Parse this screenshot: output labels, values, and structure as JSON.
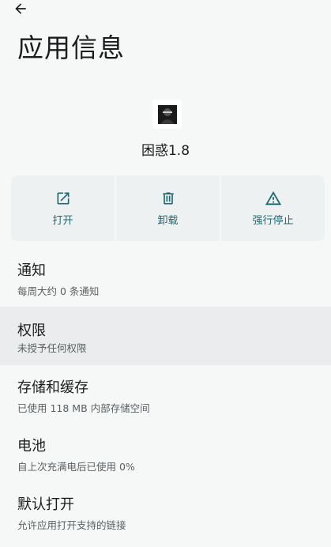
{
  "header": {
    "title": "应用信息"
  },
  "app": {
    "name": "困惑1.8"
  },
  "actions": [
    {
      "label": "打开",
      "icon": "open-external-icon"
    },
    {
      "label": "卸载",
      "icon": "trash-icon"
    },
    {
      "label": "强行停止",
      "icon": "warning-icon"
    }
  ],
  "settings": [
    {
      "title": "通知",
      "subtitle": "每周大约 0 条通知"
    },
    {
      "title": "权限",
      "subtitle": "未授予任何权限"
    },
    {
      "title": "存储和缓存",
      "subtitle": "已使用 118 MB 内部存储空间"
    },
    {
      "title": "电池",
      "subtitle": "自上次充满电后已使用 0%"
    },
    {
      "title": "默认打开",
      "subtitle": "允许应用打开支持的链接"
    }
  ],
  "colors": {
    "accent": "#1e6a72",
    "background": "#f6f8f8",
    "card": "#eef1f2",
    "highlight": "#eaeced"
  }
}
